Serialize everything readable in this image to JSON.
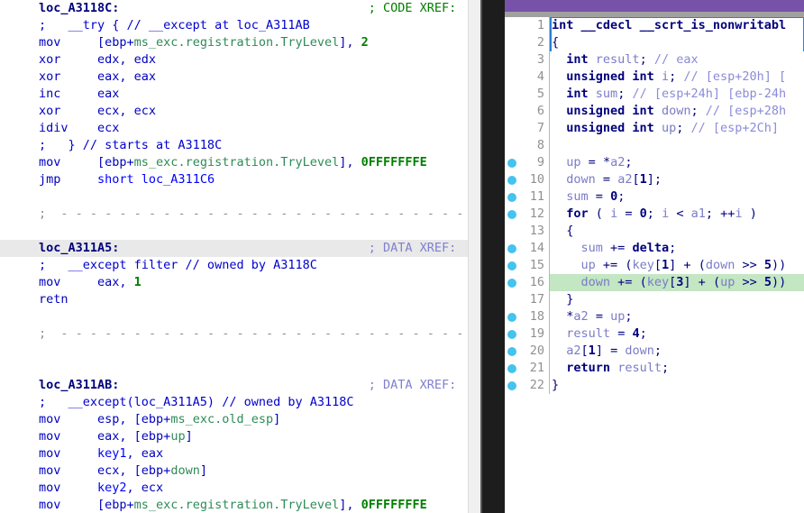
{
  "window": {
    "title_bar_color": "#7851a9",
    "splitter_color": "#1d1d1d",
    "highlight_row_color": "#e9e9e9",
    "current_line_color": "#c3e6c3",
    "breakpoint_color": "#45c3ef"
  },
  "disassembly": {
    "name": "ida-disassembly-view",
    "lines": [
      {
        "label": "loc_A3118C:",
        "xref": "; CODE XREF:",
        "type": "label"
      },
      {
        "comment": ";   __try { // __except at loc_A311AB",
        "type": "comment"
      },
      {
        "mnemonic": "mov",
        "operands": "[ebp+ms_exc.registration.TryLevel], 2",
        "type": "insn"
      },
      {
        "mnemonic": "xor",
        "operands": "edx, edx",
        "type": "insn"
      },
      {
        "mnemonic": "xor",
        "operands": "eax, eax",
        "type": "insn"
      },
      {
        "mnemonic": "inc",
        "operands": "eax",
        "type": "insn"
      },
      {
        "mnemonic": "xor",
        "operands": "ecx, ecx",
        "type": "insn"
      },
      {
        "mnemonic": "idiv",
        "operands": "ecx",
        "type": "insn"
      },
      {
        "comment": ";   } // starts at A3118C",
        "type": "comment"
      },
      {
        "mnemonic": "mov",
        "operands": "[ebp+ms_exc.registration.TryLevel], 0FFFFFFFE",
        "type": "insn"
      },
      {
        "mnemonic": "jmp",
        "operands": "short loc_A311C6",
        "type": "insn"
      },
      {
        "type": "blank"
      },
      {
        "type": "separator",
        "text": "; ---------------------------------------------------------"
      },
      {
        "type": "blank"
      },
      {
        "label": "loc_A311A5:",
        "xref": "; DATA XREF:",
        "type": "label",
        "highlighted": true
      },
      {
        "comment": ";   __except filter // owned by A3118C",
        "type": "comment"
      },
      {
        "mnemonic": "mov",
        "operands": "eax, 1",
        "type": "insn"
      },
      {
        "mnemonic": "retn",
        "operands": "",
        "type": "insn"
      },
      {
        "type": "blank"
      },
      {
        "type": "separator",
        "text": "; ---------------------------------------------------------"
      },
      {
        "type": "blank"
      },
      {
        "type": "blank"
      },
      {
        "label": "loc_A311AB:",
        "xref": "; DATA XREF:",
        "type": "label"
      },
      {
        "comment": ";   __except(loc_A311A5) // owned by A3118C",
        "type": "comment"
      },
      {
        "mnemonic": "mov",
        "operands": "esp, [ebp+ms_exc.old_esp]",
        "type": "insn"
      },
      {
        "mnemonic": "mov",
        "operands": "eax, [ebp+up]",
        "type": "insn"
      },
      {
        "mnemonic": "mov",
        "operands": "key1, eax",
        "type": "insn"
      },
      {
        "mnemonic": "mov",
        "operands": "ecx, [ebp+down]",
        "type": "insn"
      },
      {
        "mnemonic": "mov",
        "operands": "key2, ecx",
        "type": "insn"
      },
      {
        "mnemonic": "mov",
        "operands": "[ebp+ms_exc.registration.TryLevel], 0FFFFFFFE",
        "type": "insn"
      }
    ]
  },
  "pseudocode": {
    "name": "ida-pseudocode-view",
    "lines": [
      {
        "num": "1",
        "bp": false,
        "text": "int __cdecl __scrt_is_nonwritabl"
      },
      {
        "num": "2",
        "bp": false,
        "text": "{"
      },
      {
        "num": "3",
        "bp": false,
        "text": "  int result; // eax"
      },
      {
        "num": "4",
        "bp": false,
        "text": "  unsigned int i; // [esp+20h] ["
      },
      {
        "num": "5",
        "bp": false,
        "text": "  int sum; // [esp+24h] [ebp-24h"
      },
      {
        "num": "6",
        "bp": false,
        "text": "  unsigned int down; // [esp+28h"
      },
      {
        "num": "7",
        "bp": false,
        "text": "  unsigned int up; // [esp+2Ch]"
      },
      {
        "num": "8",
        "bp": false,
        "text": ""
      },
      {
        "num": "9",
        "bp": true,
        "text": "  up = *a2;"
      },
      {
        "num": "10",
        "bp": true,
        "text": "  down = a2[1];"
      },
      {
        "num": "11",
        "bp": true,
        "text": "  sum = 0;"
      },
      {
        "num": "12",
        "bp": true,
        "text": "  for ( i = 0; i < a1; ++i )"
      },
      {
        "num": "13",
        "bp": false,
        "text": "  {"
      },
      {
        "num": "14",
        "bp": true,
        "text": "    sum += delta;"
      },
      {
        "num": "15",
        "bp": true,
        "text": "    up += (key[1] + (down >> 5))"
      },
      {
        "num": "16",
        "bp": true,
        "text": "    down += (key[3] + (up >> 5))",
        "current": true
      },
      {
        "num": "17",
        "bp": false,
        "text": "  }"
      },
      {
        "num": "18",
        "bp": true,
        "text": "  *a2 = up;"
      },
      {
        "num": "19",
        "bp": true,
        "text": "  result = 4;"
      },
      {
        "num": "20",
        "bp": true,
        "text": "  a2[1] = down;"
      },
      {
        "num": "21",
        "bp": true,
        "text": "  return result;"
      },
      {
        "num": "22",
        "bp": true,
        "text": "}"
      }
    ]
  }
}
